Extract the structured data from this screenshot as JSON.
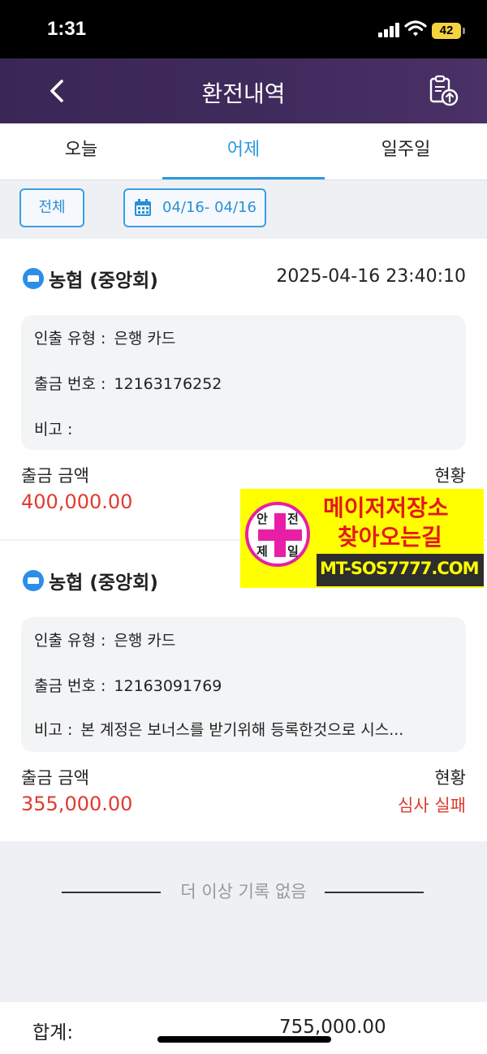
{
  "status_bar": {
    "time": "1:31",
    "battery": "42"
  },
  "nav": {
    "title": "환전내역"
  },
  "tabs": [
    {
      "label": "오늘"
    },
    {
      "label": "어제"
    },
    {
      "label": "일주일"
    }
  ],
  "filters": {
    "all_label": "전체",
    "date_range": "04/16- 04/16"
  },
  "records": [
    {
      "bank": "농협 (중앙회)",
      "datetime": "2025-04-16 23:40:10",
      "withdraw_type_label": "인출 유형 :",
      "withdraw_type": "은행 카드",
      "withdraw_no_label": "출금 번호 :",
      "withdraw_no": "12163176252",
      "note_label": "비고 :",
      "note": "",
      "amount_label": "출금 금액",
      "amount": "400,000.00",
      "status_label": "현황",
      "status": ""
    },
    {
      "bank": "농협 (중앙회)",
      "datetime": "",
      "withdraw_type_label": "인출 유형 :",
      "withdraw_type": "은행 카드",
      "withdraw_no_label": "출금 번호 :",
      "withdraw_no": "12163091769",
      "note_label": "비고 :",
      "note": "본 계정은 보너스를 받기위해 등록한것으로 시스...",
      "amount_label": "출금 금액",
      "amount": "355,000.00",
      "status_label": "현황",
      "status": "심사 실패"
    }
  ],
  "no_more_text": "더 이상 기록 없음",
  "footer": {
    "total_label": "합계:",
    "total_value": "755,000.00"
  },
  "ad_banner": {
    "logo_chars": [
      "안",
      "전",
      "제",
      "일"
    ],
    "line1": "메이저저장소",
    "line2": "찾아오는길",
    "url": "MT-SOS7777.COM"
  },
  "colors": {
    "nav_bg": "#3f2a5c",
    "accent": "#2a9be0",
    "amount": "#e03a2f",
    "ad_bg": "#ffff00"
  }
}
